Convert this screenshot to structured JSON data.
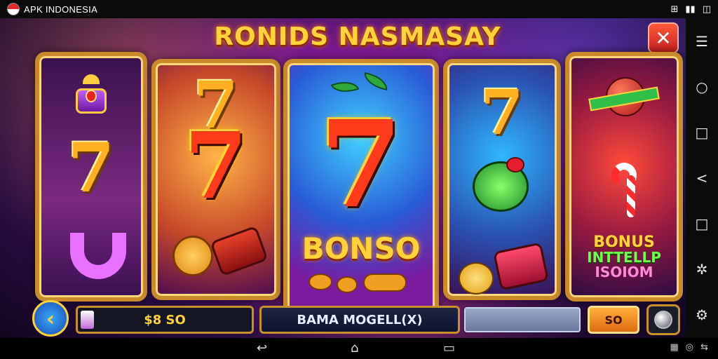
{
  "status_bar": {
    "app_name": "APK INDONESIA",
    "icons": [
      "notification-icon",
      "signal-icon",
      "battery-icon"
    ]
  },
  "game": {
    "title": "RONIDS NASMASAY",
    "reels": [
      {
        "symbols": [
          "crown",
          "7",
          "tube"
        ]
      },
      {
        "symbols": [
          "7",
          "7",
          "orange-fruit"
        ]
      },
      {
        "symbols": [
          "leaf",
          "7",
          "BONSO",
          "fruits"
        ]
      },
      {
        "symbols": [
          "7",
          "green-fruit",
          "fruits"
        ]
      },
      {
        "symbols": [
          "ball-banner",
          "candy-cane",
          "BONUS INTTELLP ISOIOM"
        ]
      }
    ],
    "reel_labels": {
      "seven": "7",
      "bonso": "BONSO",
      "bonus_l1": "BONUS",
      "bonus_l2": "INTTELLP",
      "bonus_l3": "ISOIOM"
    },
    "balance": {
      "value": "$8 SO",
      "fill_fraction": 0.08
    },
    "mode_label": "BAMA MOGELL(X)",
    "bet_value": "SO",
    "colors": {
      "accent": "#ffd23a",
      "frame": "#c9902a",
      "close": "#e02a2a"
    }
  },
  "side_nav": [
    "menu-icon",
    "search-icon",
    "square-icon",
    "share-icon",
    "square-icon",
    "puzzle-icon",
    "settings-icon"
  ],
  "bottom_nav": [
    "back-icon",
    "home-icon",
    "recents-icon"
  ]
}
